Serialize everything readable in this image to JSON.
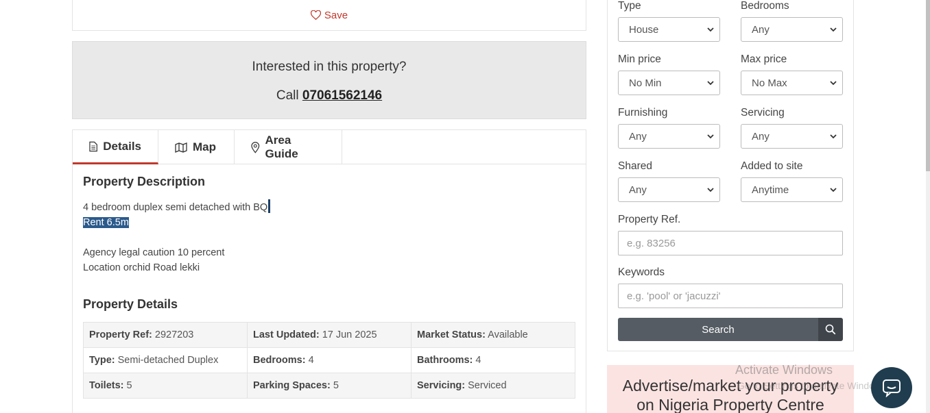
{
  "save": {
    "label": "Save"
  },
  "contact": {
    "question": "Interested in this property?",
    "call_prefix": "Call ",
    "phone": "07061562146"
  },
  "tabs": [
    {
      "label": "Details",
      "icon": "document-icon"
    },
    {
      "label": "Map",
      "icon": "map-icon"
    },
    {
      "label": "Area Guide",
      "icon": "location-pin-icon"
    }
  ],
  "description": {
    "heading": "Property Description",
    "line1": "4 bedroom duplex semi detached with BQ",
    "line2": "Rent 6.5m",
    "line3": "Agency legal caution 10 percent",
    "line4": "Location orchid Road lekki"
  },
  "details": {
    "heading": "Property Details",
    "rows": [
      [
        {
          "k": "Property Ref:",
          "v": "2927203"
        },
        {
          "k": "Last Updated:",
          "v": "17 Jun 2025"
        },
        {
          "k": "Market Status:",
          "v": "Available"
        }
      ],
      [
        {
          "k": "Type:",
          "v": "Semi-detached Duplex"
        },
        {
          "k": "Bedrooms:",
          "v": "4"
        },
        {
          "k": "Bathrooms:",
          "v": "4"
        }
      ],
      [
        {
          "k": "Toilets:",
          "v": "5"
        },
        {
          "k": "Parking Spaces:",
          "v": "5"
        },
        {
          "k": "Servicing:",
          "v": "Serviced"
        }
      ]
    ]
  },
  "search": {
    "type_label": "Type",
    "type_value": "House",
    "bedrooms_label": "Bedrooms",
    "bedrooms_value": "Any",
    "minprice_label": "Min price",
    "minprice_value": "No Min",
    "maxprice_label": "Max price",
    "maxprice_value": "No Max",
    "furnishing_label": "Furnishing",
    "furnishing_value": "Any",
    "servicing_label": "Servicing",
    "servicing_value": "Any",
    "shared_label": "Shared",
    "shared_value": "Any",
    "added_label": "Added to site",
    "added_value": "Anytime",
    "ref_label": "Property Ref.",
    "ref_placeholder": "e.g. 83256",
    "keywords_label": "Keywords",
    "keywords_placeholder": "e.g. 'pool' or 'jacuzzi'",
    "button_label": "Search"
  },
  "advert": {
    "line1": "Advertise/market your property",
    "line2": "on Nigeria Property Centre"
  },
  "watermark": {
    "title": "Activate Windows",
    "subtitle": "Go to Settings to activate Windows."
  },
  "colors": {
    "accent": "#c0392b",
    "button": "#555c63",
    "chat": "#1f3d4f"
  }
}
